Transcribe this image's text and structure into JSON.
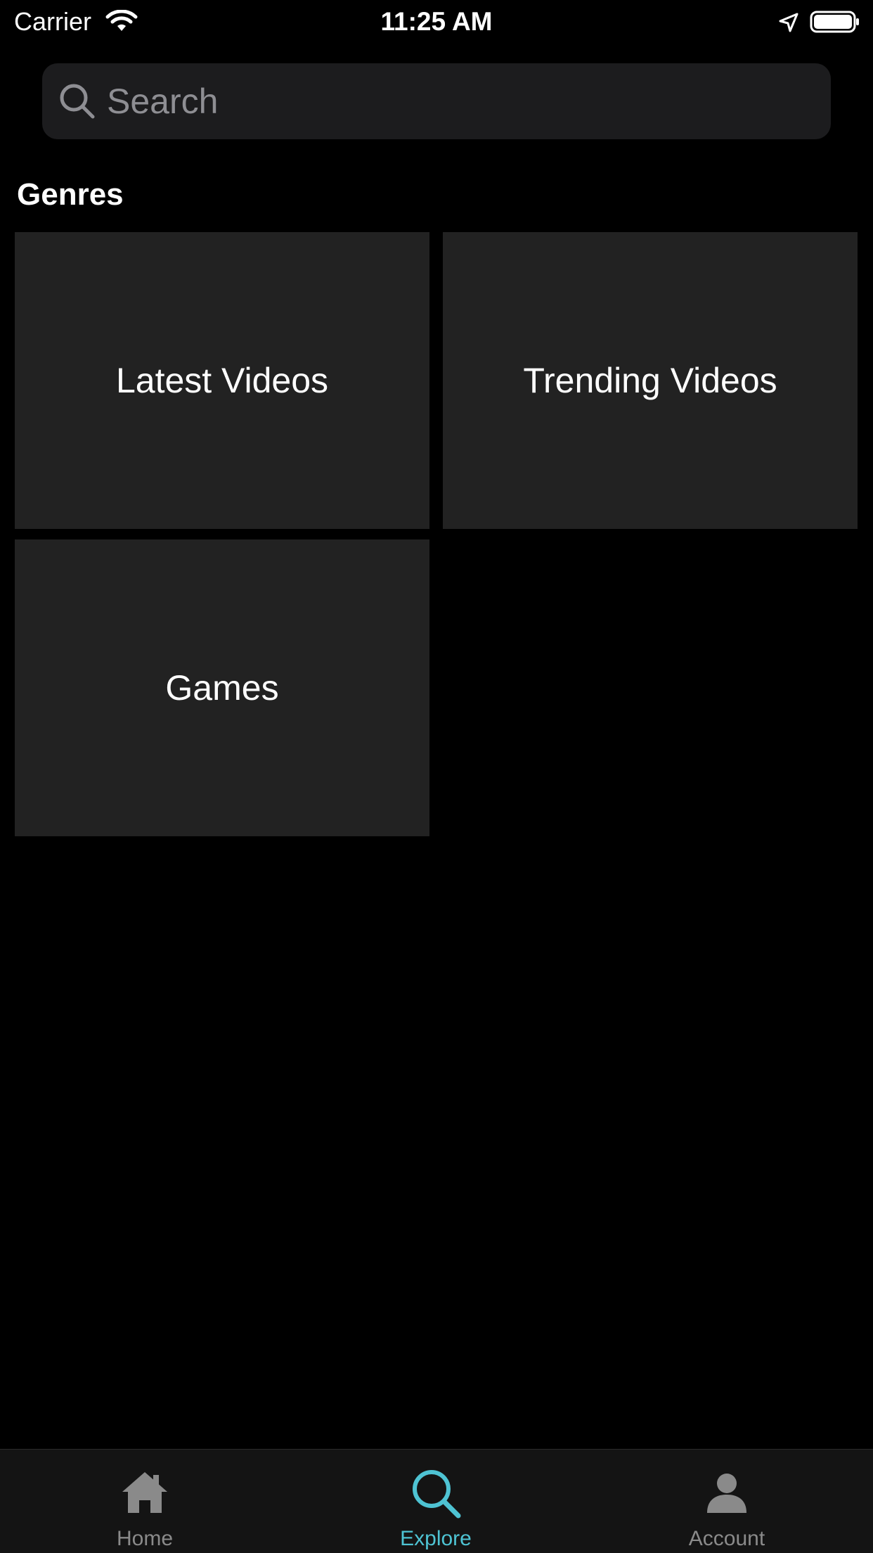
{
  "status_bar": {
    "carrier": "Carrier",
    "time": "11:25 AM",
    "icons": [
      "wifi-icon",
      "location-arrow-icon",
      "battery-icon"
    ]
  },
  "search": {
    "placeholder": "Search",
    "value": "",
    "icon": "search-icon"
  },
  "genres": {
    "title": "Genres",
    "items": [
      {
        "label": "Latest Videos"
      },
      {
        "label": "Trending Videos"
      },
      {
        "label": "Games"
      }
    ]
  },
  "tab_bar": {
    "active_color": "#4ec3d3",
    "inactive_color": "#8a8a8a",
    "active_tab": "Explore",
    "tabs": [
      {
        "label": "Home",
        "icon": "house-icon"
      },
      {
        "label": "Explore",
        "icon": "search-icon"
      },
      {
        "label": "Account",
        "icon": "person-icon"
      }
    ]
  }
}
